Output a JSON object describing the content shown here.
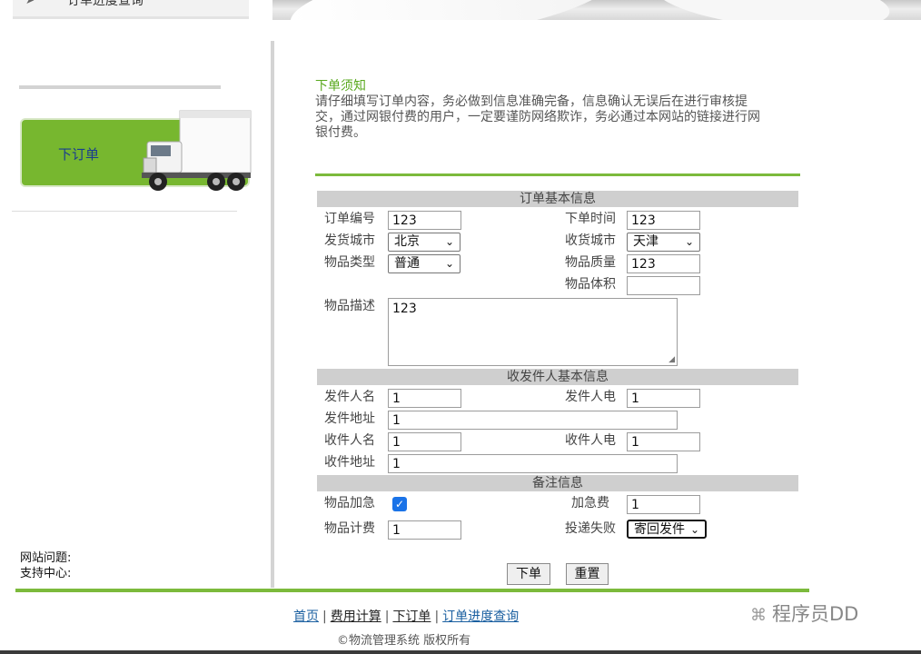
{
  "header": {
    "cut_menu_text": "订单进度查询"
  },
  "sidebar": {
    "order_banner_label": "下订单",
    "help_line1": "网站问题:",
    "help_line2": "支持中心:"
  },
  "notice": {
    "title": "下单须知",
    "line1": "请仔细填写订单内容，务必做到信息准确完备，信息确认无误后在进行审核提",
    "line2": "交，通过网银付费的用户，一定要谨防网络欺诈，务必通过本网站的链接进行网",
    "line3": "银付费。"
  },
  "sections": {
    "basic": "订单基本信息",
    "people": "收发件人基本信息",
    "remarks": "备注信息"
  },
  "form": {
    "order_no": {
      "label": "订单编号",
      "value": "123"
    },
    "order_time": {
      "label": "下单时间",
      "value": "123"
    },
    "from_city": {
      "label": "发货城市",
      "value": "北京"
    },
    "to_city": {
      "label": "收货城市",
      "value": "天津"
    },
    "goods_type": {
      "label": "物品类型",
      "value": "普通"
    },
    "goods_weight": {
      "label": "物品质量",
      "value": "123"
    },
    "goods_volume": {
      "label": "物品体积",
      "value": ""
    },
    "goods_desc": {
      "label": "物品描述",
      "value": "123"
    },
    "sender_name": {
      "label": "发件人名",
      "value": "1"
    },
    "sender_phone": {
      "label": "发件人电",
      "value": "1"
    },
    "sender_addr": {
      "label": "发件地址",
      "value": "1"
    },
    "receiver_name": {
      "label": "收件人名",
      "value": "1"
    },
    "receiver_phone": {
      "label": "收件人电",
      "value": "1"
    },
    "receiver_addr": {
      "label": "收件地址",
      "value": "1"
    },
    "urgent": {
      "label": "物品加急",
      "checked": true
    },
    "urgent_fee": {
      "label": "加急费",
      "value": "1"
    },
    "billing": {
      "label": "物品计费",
      "value": "1"
    },
    "delivery_fail": {
      "label": "投递失败",
      "value": "寄回发件"
    }
  },
  "buttons": {
    "submit": "下单",
    "reset": "重置"
  },
  "footer": {
    "links": [
      "首页",
      "费用计算",
      "下订单",
      "订单进度查询"
    ],
    "separator": "|",
    "copyright": "©物流管理系统 版权所有"
  },
  "watermark": {
    "text": "程序员DD",
    "icon": "wechat-icon"
  },
  "colors": {
    "accent_green": "#7cba3c",
    "banner_green": "#77b72f",
    "link_blue": "#1a5fa0",
    "checkbox_blue": "#1a73e8"
  }
}
